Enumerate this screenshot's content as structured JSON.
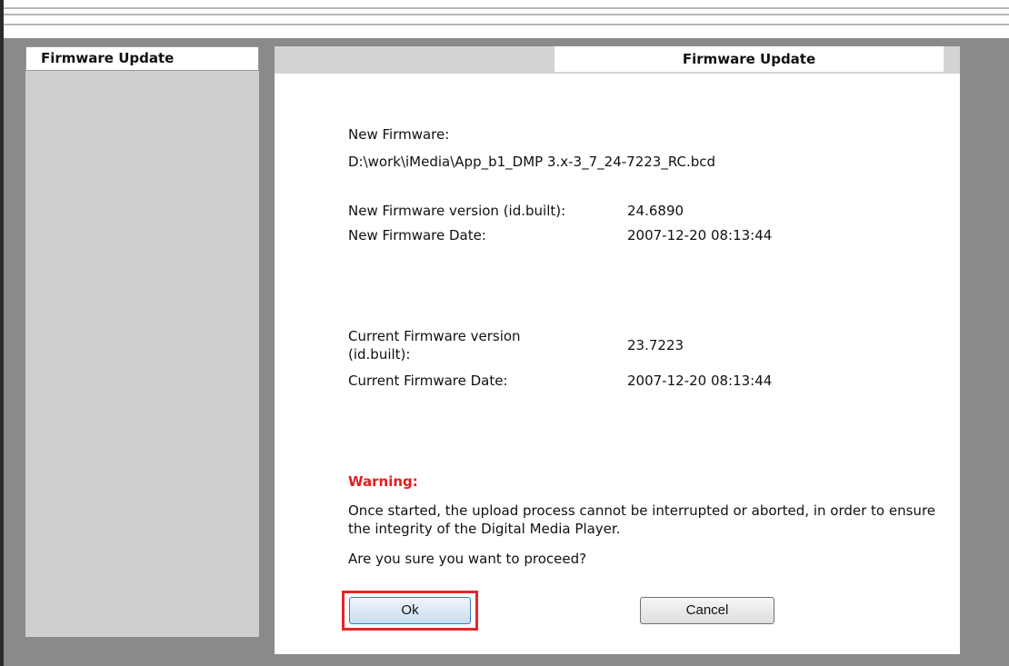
{
  "sidebar": {
    "header": "Firmware Update"
  },
  "main": {
    "tab_title": "Firmware Update",
    "new_firmware_label": "New Firmware:",
    "new_firmware_path": "D:\\work\\iMedia\\App_b1_DMP 3.x-3_7_24-7223_RC.bcd",
    "new_version_label": "New Firmware version (id.built):",
    "new_version_value": "24.6890",
    "new_date_label": "New Firmware Date:",
    "new_date_value": "2007-12-20  08:13:44",
    "current_version_label_line1": "Current Firmware version",
    "current_version_label_line2": "(id.built):",
    "current_version_value": "23.7223",
    "current_date_label": "Current Firmware Date:",
    "current_date_value": "2007-12-20  08:13:44",
    "warning_title": "Warning:",
    "warning_message": "Once started, the upload process cannot be interrupted or aborted, in order to ensure the integrity of the Digital Media Player.",
    "confirm_question": "Are you sure you want to proceed?",
    "ok_label": "Ok",
    "cancel_label": "Cancel"
  },
  "colors": {
    "warning": "#e02020",
    "highlight": "#e8252b",
    "background": "#8a8a8a",
    "sidebar": "#cfcfcf"
  }
}
